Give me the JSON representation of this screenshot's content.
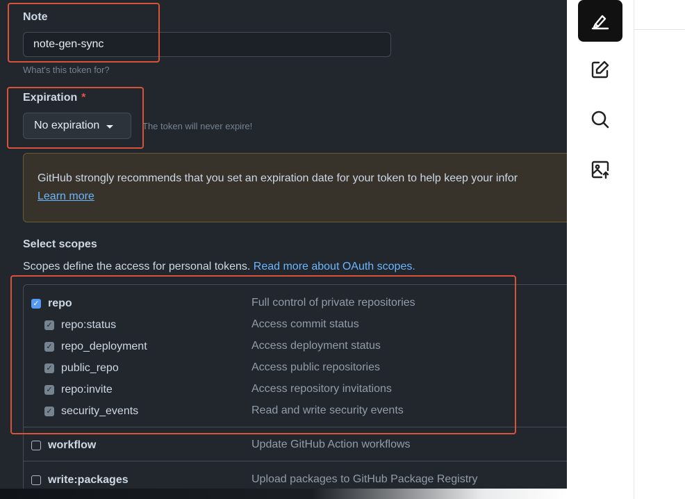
{
  "form": {
    "note": {
      "label": "Note",
      "value": "note-gen-sync",
      "hint": "What's this token for?"
    },
    "expiration": {
      "label": "Expiration",
      "required_mark": "*",
      "selected": "No expiration",
      "helper": "The token will never expire!"
    },
    "warning": {
      "text": "GitHub strongly recommends that you set an expiration date for your token to help keep your infor",
      "link": "Learn more"
    },
    "scopes": {
      "title": "Select scopes",
      "description": "Scopes define the access for personal tokens.",
      "link": "Read more about OAuth scopes.",
      "items": [
        {
          "name": "repo",
          "description": "Full control of private repositories",
          "checked": true,
          "level": 0
        },
        {
          "name": "repo:status",
          "description": "Access commit status",
          "checked": true,
          "level": 1
        },
        {
          "name": "repo_deployment",
          "description": "Access deployment status",
          "checked": true,
          "level": 1
        },
        {
          "name": "public_repo",
          "description": "Access public repositories",
          "checked": true,
          "level": 1
        },
        {
          "name": "repo:invite",
          "description": "Access repository invitations",
          "checked": true,
          "level": 1
        },
        {
          "name": "security_events",
          "description": "Read and write security events",
          "checked": true,
          "level": 1
        },
        {
          "name": "workflow",
          "description": "Update GitHub Action workflows",
          "checked": false,
          "level": 0
        },
        {
          "name": "write:packages",
          "description": "Upload packages to GitHub Package Registry",
          "checked": false,
          "level": 0
        }
      ]
    }
  },
  "toolbar": {
    "tools": [
      {
        "icon": "highlighter-icon",
        "active": true
      },
      {
        "icon": "edit-icon",
        "active": false
      },
      {
        "icon": "search-icon",
        "active": false
      },
      {
        "icon": "image-upload-icon",
        "active": false
      }
    ]
  },
  "colors": {
    "background": "#22272e",
    "accent": "#539bf5",
    "link": "#6cb6ff",
    "highlight_box": "#d9533b",
    "danger": "#e5534b"
  }
}
